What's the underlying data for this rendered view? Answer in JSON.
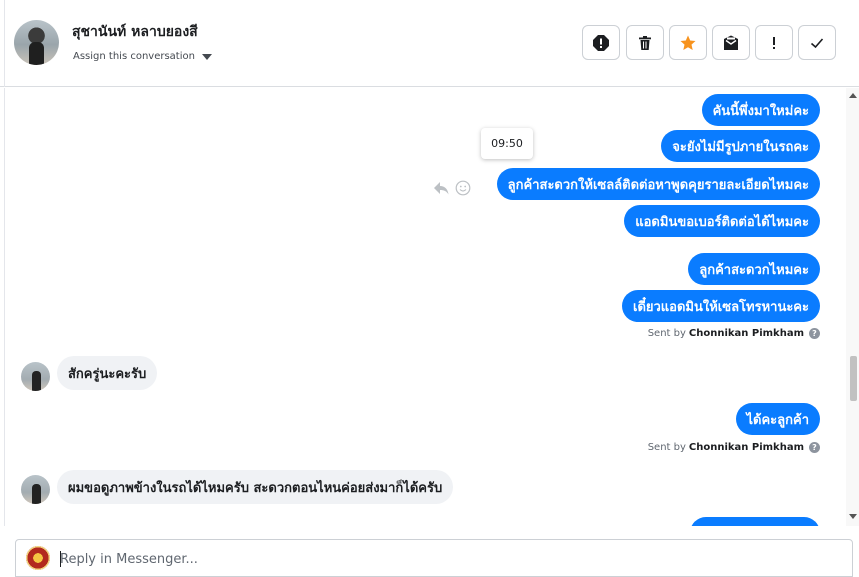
{
  "header": {
    "contact_name": "สุชานันท์ หลาบยองสี",
    "assign_label": "Assign this conversation"
  },
  "toolbar": {
    "icons": [
      "spam-icon",
      "trash-icon",
      "star-icon",
      "mark-unread-icon",
      "follow-up-icon",
      "done-icon"
    ],
    "star_color": "#f7931e"
  },
  "tooltip": {
    "time": "09:50"
  },
  "messages": {
    "out1": "คันนี้พึ่งมาใหม่คะ",
    "out2": "จะยังไม่มีรูปภายในรถคะ",
    "out3": "ลูกค้าสะดวกให้เซลล์ติดต่อหาพูดคุยรายละเอียดไหมคะ",
    "out4": "แอดมินขอเบอร์ติดต่อได้ไหมคะ",
    "out5": "ลูกค้าสะดวกไหมคะ",
    "out6": "เดี๋ยวแอดมินให้เซลโทรหานะคะ",
    "in1": "สักครู่นะคะรับ",
    "out7": "ได้คะลูกค้า",
    "in2": "ผมขอดูภาพข้างในรถได้ไหมครับ สะดวกตอนไหนค่อยส่งมาก็ได้ครับ"
  },
  "sent_by": {
    "prefix": "Sent by",
    "agent": "Chonnikan Pimkham",
    "help_glyph": "?"
  },
  "composer": {
    "placeholder": "Reply in Messenger..."
  },
  "colors": {
    "outgoing_bubble": "#0a7cff",
    "incoming_bubble": "#f0f2f5"
  }
}
